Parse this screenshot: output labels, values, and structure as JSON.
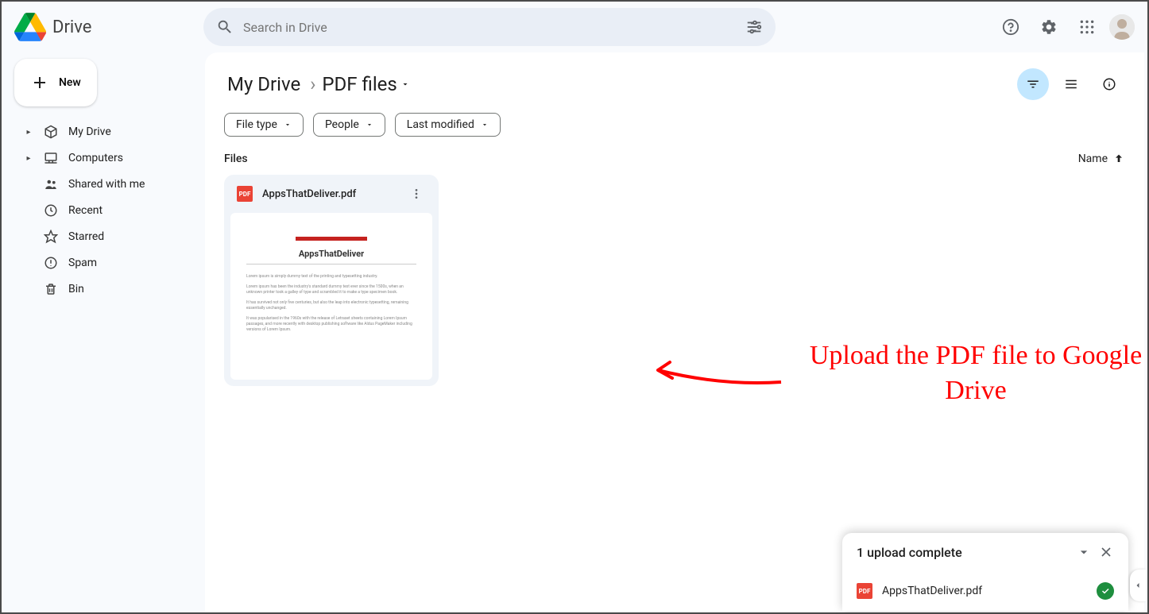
{
  "app": {
    "name": "Drive"
  },
  "search": {
    "placeholder": "Search in Drive"
  },
  "sidebar": {
    "new_label": "New",
    "items": [
      {
        "label": "My Drive",
        "expandable": true
      },
      {
        "label": "Computers",
        "expandable": true
      },
      {
        "label": "Shared with me",
        "expandable": false
      },
      {
        "label": "Recent",
        "expandable": false
      },
      {
        "label": "Starred",
        "expandable": false
      },
      {
        "label": "Spam",
        "expandable": false
      },
      {
        "label": "Bin",
        "expandable": false
      }
    ]
  },
  "breadcrumb": {
    "root": "My Drive",
    "current": "PDF files"
  },
  "filters": {
    "file_type": "File type",
    "people": "People",
    "last_modified": "Last modified"
  },
  "section": {
    "title": "Files",
    "sort_label": "Name"
  },
  "files": [
    {
      "name": "AppsThatDeliver.pdf",
      "preview_title": "AppsThatDeliver"
    }
  ],
  "annotation": {
    "text": "Upload the PDF file to Google Drive"
  },
  "upload_toast": {
    "title": "1 upload complete",
    "items": [
      {
        "name": "AppsThatDeliver.pdf"
      }
    ]
  }
}
